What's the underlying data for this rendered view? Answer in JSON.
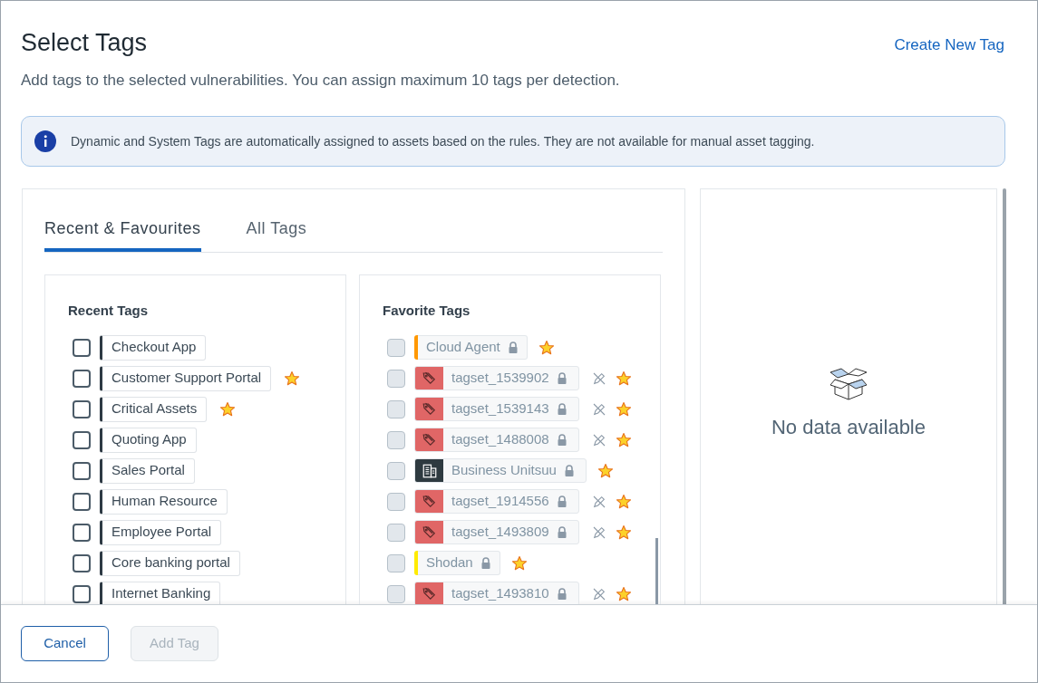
{
  "dialog": {
    "title": "Select Tags",
    "create_link": "Create New Tag",
    "subtitle": "Add tags to the selected vulnerabilities. You can assign maximum 10 tags per detection."
  },
  "notice": "Dynamic and System Tags are automatically assigned to assets based on the rules. They are not available for manual asset tagging.",
  "tabs": [
    {
      "label": "Recent & Favourites",
      "selected": true
    },
    {
      "label": "All Tags",
      "selected": false
    }
  ],
  "recent": {
    "title": "Recent Tags",
    "tags": [
      {
        "name": "Checkout App",
        "checked": false,
        "favorite": false
      },
      {
        "name": "Customer Support Portal",
        "checked": false,
        "favorite": true
      },
      {
        "name": "Critical Assets",
        "checked": false,
        "favorite": true
      },
      {
        "name": "Quoting App",
        "checked": false,
        "favorite": false
      },
      {
        "name": "Sales Portal",
        "checked": false,
        "favorite": false
      },
      {
        "name": "Human Resource",
        "checked": false,
        "favorite": false
      },
      {
        "name": "Employee Portal",
        "checked": false,
        "favorite": false
      },
      {
        "name": "Core banking portal",
        "checked": false,
        "favorite": false
      },
      {
        "name": "Internet Banking",
        "checked": false,
        "favorite": false
      }
    ]
  },
  "favorites": {
    "title": "Favorite Tags",
    "tags": [
      {
        "kind": "color",
        "color": "#ff9800",
        "name": "Cloud Agent",
        "disabled": true,
        "editable": false
      },
      {
        "kind": "tagset",
        "name": "tagset_1539902",
        "disabled": true,
        "editable": true
      },
      {
        "kind": "tagset",
        "name": "tagset_1539143",
        "disabled": true,
        "editable": true
      },
      {
        "kind": "tagset",
        "name": "tagset_1488008",
        "disabled": true,
        "editable": true
      },
      {
        "kind": "business_unit",
        "name": "Business Unitsuu",
        "disabled": true,
        "editable": false
      },
      {
        "kind": "tagset",
        "name": "tagset_1914556",
        "disabled": true,
        "editable": true
      },
      {
        "kind": "tagset",
        "name": "tagset_1493809",
        "disabled": true,
        "editable": true
      },
      {
        "kind": "color",
        "color": "#ffeb00",
        "name": "Shodan",
        "disabled": true,
        "editable": false
      },
      {
        "kind": "tagset",
        "name": "tagset_1493810",
        "disabled": true,
        "editable": true
      }
    ]
  },
  "selection_panel": {
    "empty_text": "No data available"
  },
  "buttons": {
    "cancel": "Cancel",
    "add": {
      "label": "Add Tag",
      "disabled": true
    }
  }
}
